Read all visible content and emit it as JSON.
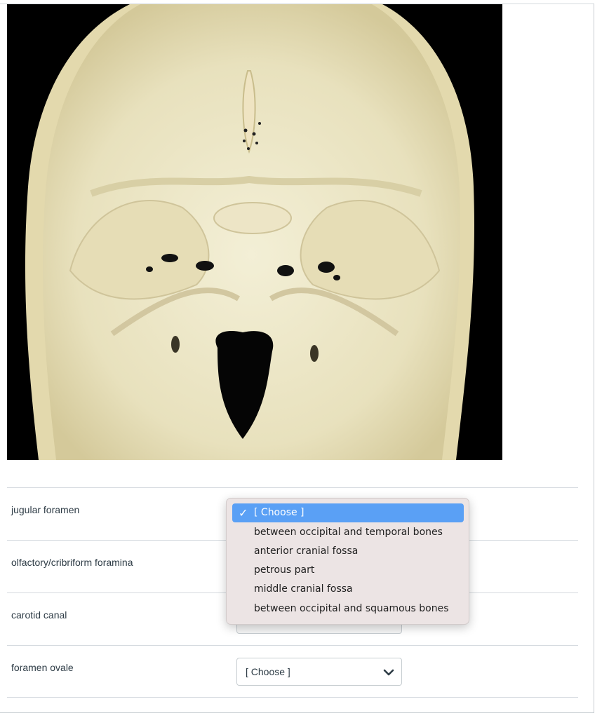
{
  "image": {
    "alt": ""
  },
  "questions": [
    {
      "label": "jugular foramen",
      "select_value": ""
    },
    {
      "label": "olfactory/cribriform foramina",
      "select_value": ""
    },
    {
      "label": "carotid canal",
      "select_value": ""
    },
    {
      "label": "foramen ovale",
      "select_value": "[ Choose ]"
    }
  ],
  "dropdown": {
    "options": [
      "[ Choose ]",
      "between occipital and temporal bones",
      "anterior cranial fossa",
      "petrous part",
      "middle cranial fossa",
      "between occipital and squamous bones"
    ],
    "selected_index": 0
  },
  "icons": {
    "check": "checkmark-icon",
    "chevron": "chevron-down-icon"
  },
  "colors": {
    "highlight": "#5aa0f5",
    "menu_bg": "#ece4e4",
    "text": "#2d3b45",
    "border": "#c7cdd1"
  }
}
